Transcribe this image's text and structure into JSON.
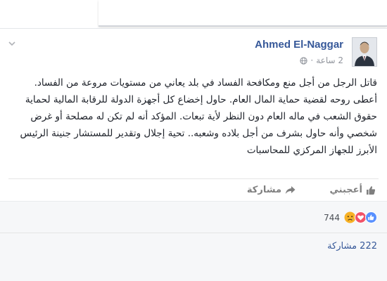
{
  "post": {
    "author": "Ahmed El-Naggar",
    "time": "2 ساعة",
    "separator": "·",
    "text": "قاتل الرجل من أجل منع ومكافحة الفساد في بلد يعاني من مستويات مروعة من الفساد. أعطى روحه لقضية حماية المال العام. حاول إخضاع كل أجهزة الدولة للرقابة المالية لحماية حقوق الشعب في ماله العام دون النظر لأية تبعات. المؤكد أنه لم تكن له مصلحة أو غرض شخصي وأنه حاول بشرف من أجل بلاده وشعبه.. تحية إجلال وتقدير للمستشار جنينة الرئيس الأبرز للجهاز المركزي للمحاسبات"
  },
  "actions": {
    "like_label": "أعجبني",
    "share_label": "مشاركة"
  },
  "stats": {
    "reactions_count": "744",
    "shares": "222 مشاركة"
  },
  "icons": {
    "chevron": "chevron-down-icon",
    "globe": "globe-icon",
    "like": "thumbs-up-icon",
    "share": "share-arrow-icon"
  },
  "colors": {
    "link_blue": "#365899",
    "like_blue": "#5890ff",
    "love_red": "#f25268",
    "sad_yellow": "#f7b125",
    "muted_text": "#90949c"
  }
}
